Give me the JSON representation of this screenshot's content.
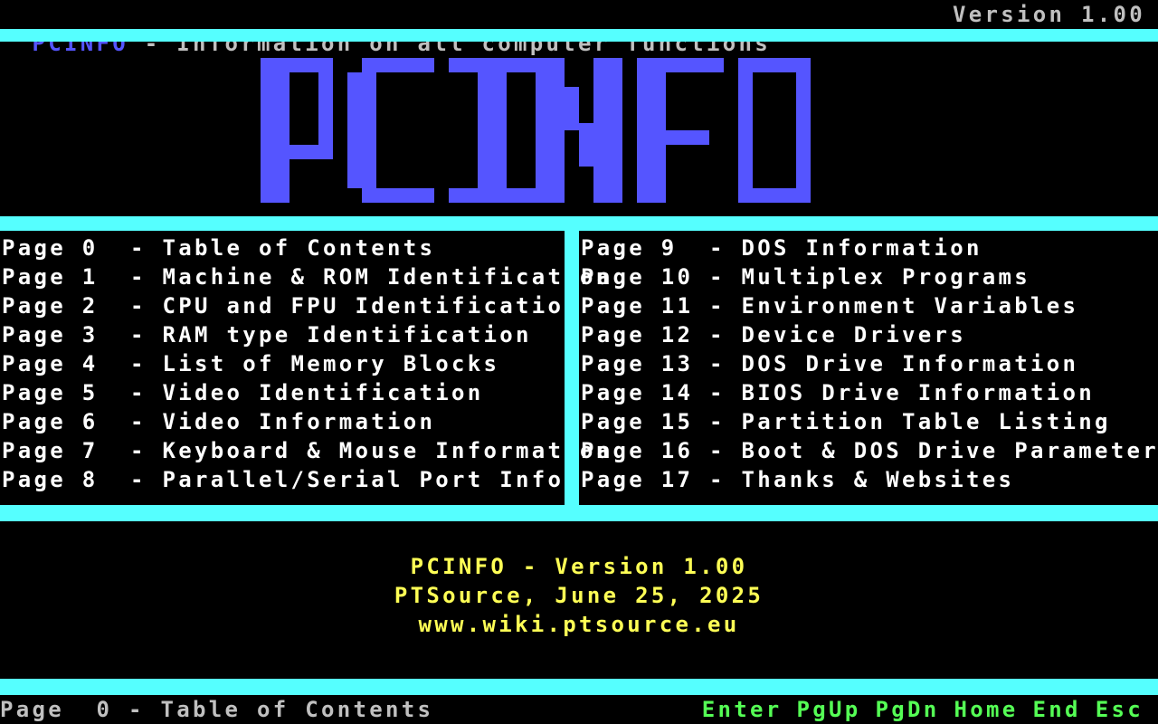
{
  "title_bar": {
    "app_name": "PCINFO",
    "description": " - Information on all computer functions",
    "version": "Version 1.00"
  },
  "logo": {
    "text": "PCINFO"
  },
  "menu": {
    "left": [
      {
        "page": "Page 0 ",
        "sep": " - ",
        "label": "Table of Contents"
      },
      {
        "page": "Page 1 ",
        "sep": " - ",
        "label": "Machine & ROM Identification"
      },
      {
        "page": "Page 2 ",
        "sep": " - ",
        "label": "CPU and FPU Identification"
      },
      {
        "page": "Page 3 ",
        "sep": " - ",
        "label": "RAM type Identification"
      },
      {
        "page": "Page 4 ",
        "sep": " - ",
        "label": "List of Memory Blocks"
      },
      {
        "page": "Page 5 ",
        "sep": " - ",
        "label": "Video Identification"
      },
      {
        "page": "Page 6 ",
        "sep": " - ",
        "label": "Video Information"
      },
      {
        "page": "Page 7 ",
        "sep": " - ",
        "label": "Keyboard & Mouse Information"
      },
      {
        "page": "Page 8 ",
        "sep": " - ",
        "label": "Parallel/Serial Port Info"
      }
    ],
    "right": [
      {
        "page": "Page 9 ",
        "sep": " - ",
        "label": "DOS Information"
      },
      {
        "page": "Page 10",
        "sep": " - ",
        "label": "Multiplex Programs"
      },
      {
        "page": "Page 11",
        "sep": " - ",
        "label": "Environment Variables"
      },
      {
        "page": "Page 12",
        "sep": " - ",
        "label": "Device Drivers"
      },
      {
        "page": "Page 13",
        "sep": " - ",
        "label": "DOS Drive Information"
      },
      {
        "page": "Page 14",
        "sep": " - ",
        "label": "BIOS Drive Information"
      },
      {
        "page": "Page 15",
        "sep": " - ",
        "label": "Partition Table Listing"
      },
      {
        "page": "Page 16",
        "sep": " - ",
        "label": "Boot & DOS Drive Parameters"
      },
      {
        "page": "Page 17",
        "sep": " - ",
        "label": "Thanks & Websites"
      }
    ]
  },
  "credits": {
    "line1": "PCINFO - Version 1.00",
    "line2": "PTSource, June 25, 2025",
    "line3": "www.wiki.ptsource.eu"
  },
  "status_bar": {
    "current_page": "Page  0 - Table of Contents",
    "keys": [
      "Enter",
      "PgUp",
      "PgDn",
      "Home",
      "End",
      "Esc"
    ]
  },
  "colors": {
    "background": "#000000",
    "bars": "#55ffff",
    "logo": "#5555ff",
    "credits": "#ffff55",
    "keys": "#55ff55",
    "menu_text": "#ffffff"
  }
}
